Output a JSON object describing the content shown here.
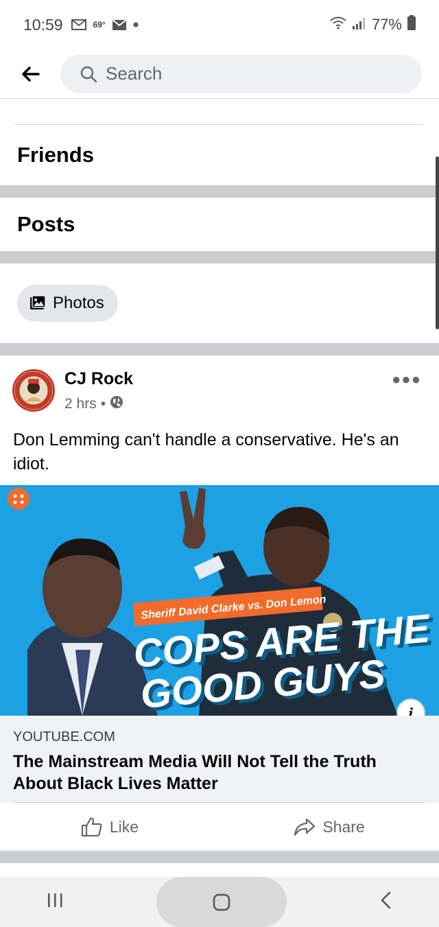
{
  "status": {
    "time": "10:59",
    "temperature": "69°",
    "battery": "77%"
  },
  "search": {
    "placeholder": "Search"
  },
  "sections": {
    "friends": "Friends",
    "posts": "Posts"
  },
  "filter_chip": {
    "label": "Photos",
    "icon": "photos-icon"
  },
  "post": {
    "author": "CJ Rock",
    "time": "2 hrs",
    "separator": "•",
    "privacy_icon": "globe-icon",
    "text": "Don Lemming can't handle a conservative. He's an idiot.",
    "link": {
      "banner_text": "Sheriff David Clarke vs. Don Lemon",
      "headline_line1": "COPS ARE THE",
      "headline_line2": "GOOD GUYS",
      "domain": "YOUTUBE.COM",
      "title": "The Mainstream Media Will Not Tell the Truth About Black Lives Matter",
      "info_glyph": "i"
    },
    "actions": {
      "like": "Like",
      "share": "Share"
    }
  },
  "colors": {
    "accent_blue": "#1da1e5",
    "banner_orange": "#f26b2a",
    "divider_gray": "#c9ccd1"
  }
}
